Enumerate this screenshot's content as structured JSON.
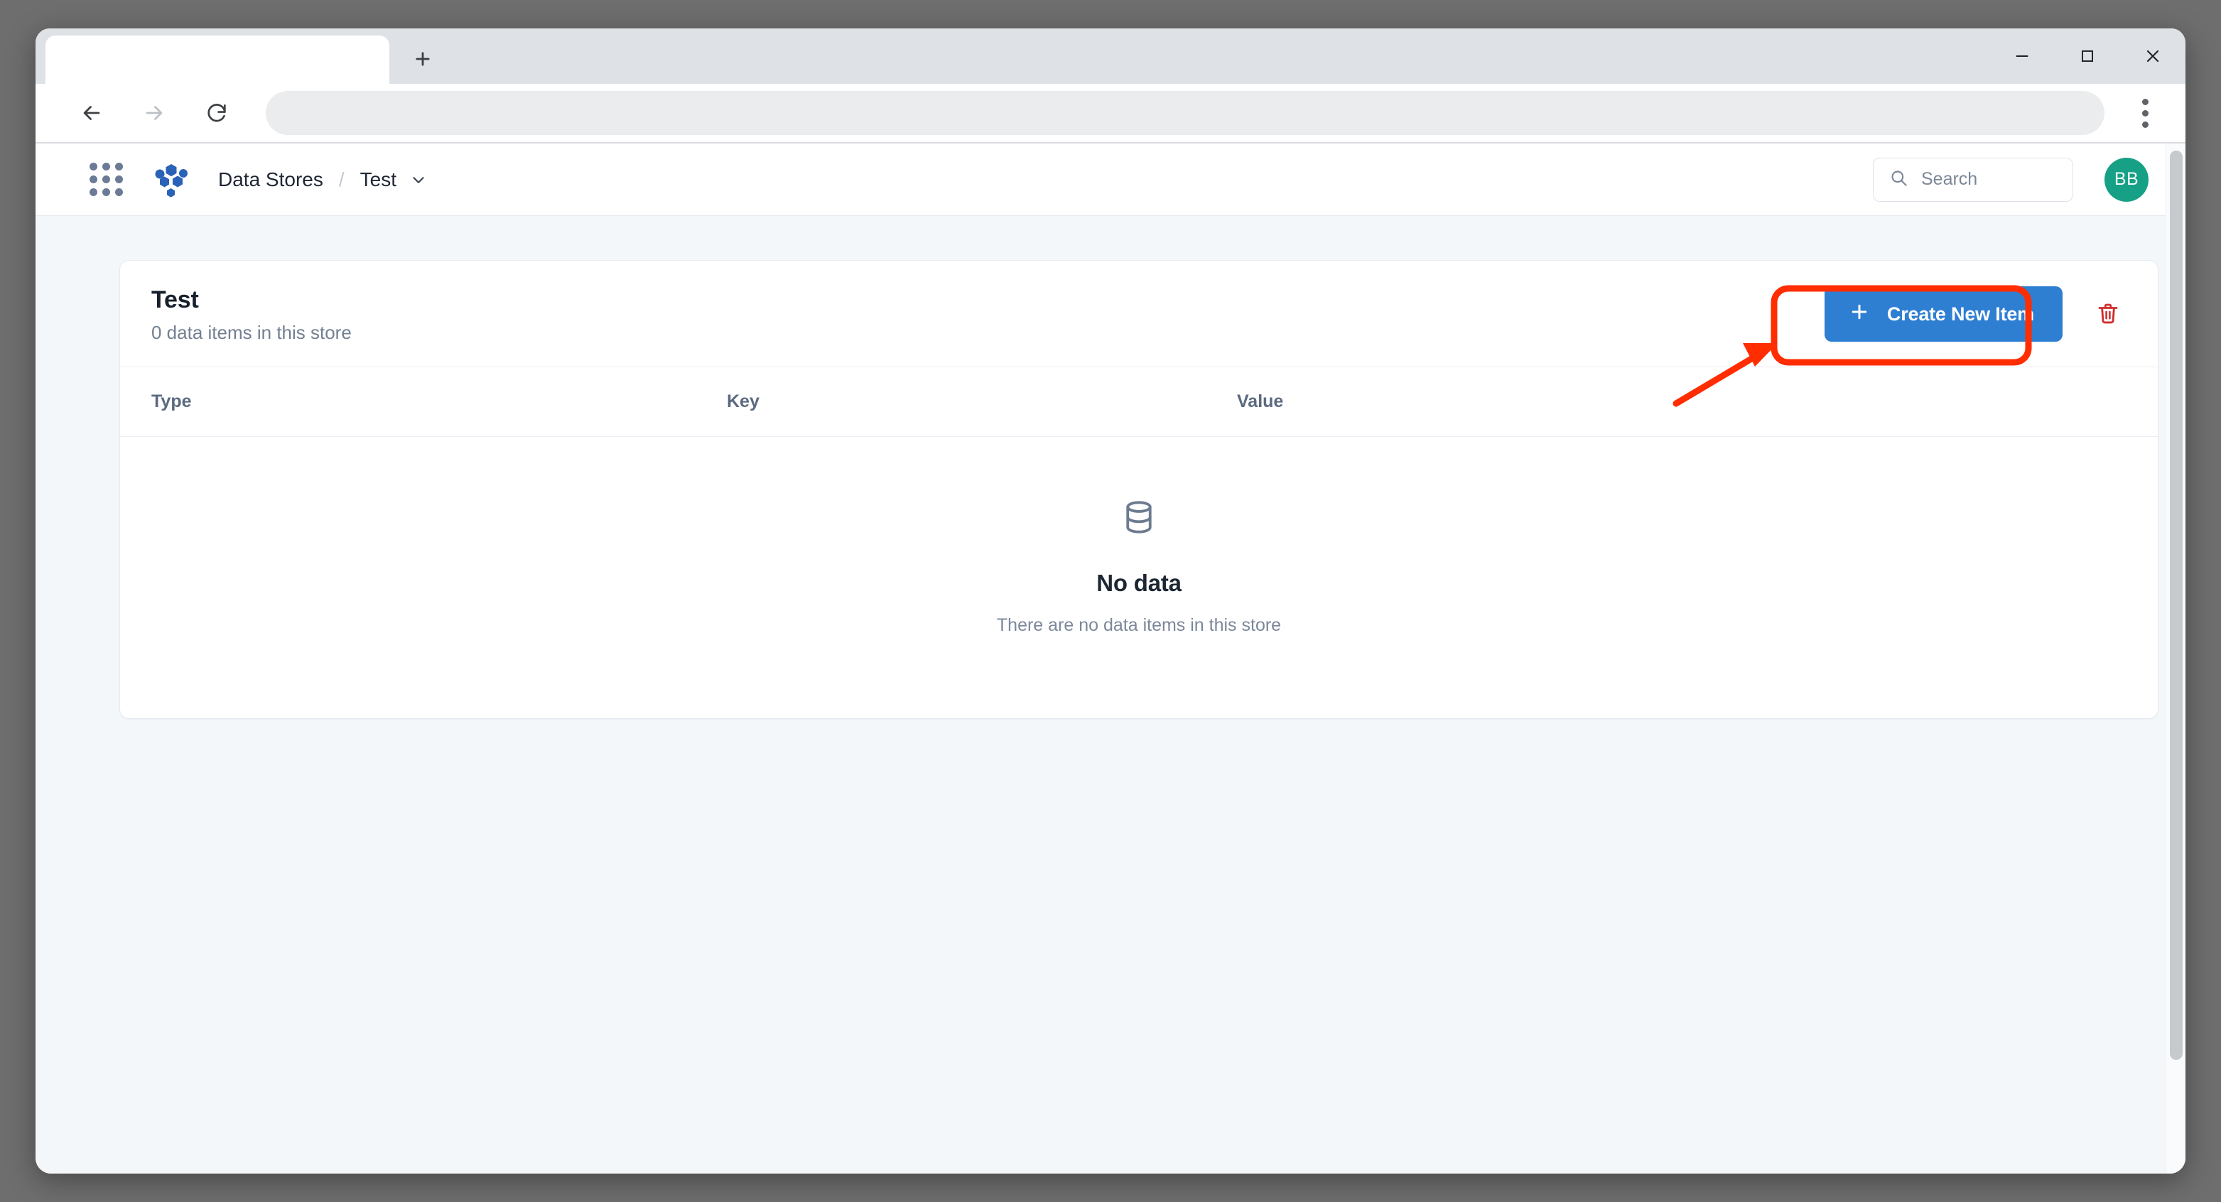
{
  "browser": {
    "tab": {
      "title": "",
      "name": "browser-tab"
    },
    "new_tab_label": "+",
    "window_controls": {
      "minimize": "—",
      "maximize": "□",
      "close": "✕"
    },
    "toolbar": {
      "back_icon": "arrow-left-icon",
      "forward_icon": "arrow-right-icon",
      "reload_icon": "reload-icon",
      "address_value": "",
      "menu_icon": "kebab-menu-icon"
    }
  },
  "app_header": {
    "apps_grid_icon": "apps-grid-icon",
    "logo_icon": "hexagon-cluster-logo",
    "breadcrumb": {
      "root": "Data Stores",
      "separator": "/",
      "current": "Test",
      "caret_icon": "chevron-down-icon"
    },
    "search": {
      "placeholder": "Search",
      "value": "",
      "icon": "search-icon"
    },
    "avatar": {
      "initials": "BB",
      "color": "#16a085"
    }
  },
  "card": {
    "title": "Test",
    "subtitle": "0 data items in this store",
    "create_button": {
      "label": "Create New Item",
      "icon": "plus-icon",
      "color": "#2e7fd1"
    },
    "delete_button": {
      "icon": "trash-icon",
      "color": "#cf2e2e"
    },
    "table": {
      "columns": [
        "Type",
        "Key",
        "Value"
      ],
      "rows": []
    },
    "empty_state": {
      "icon": "database-icon",
      "title": "No data",
      "subtitle": "There are no data items in this store"
    }
  },
  "annotation": {
    "highlight_color": "#ff2d00",
    "highlight_target": "create-new-item-button",
    "arrow": "red-arrow-pointing-to-create-new-item-button"
  },
  "colors": {
    "page_background": "#f4f7fa",
    "card_background": "#ffffff",
    "primary": "#2e7fd1",
    "danger": "#cf2e2e",
    "avatar": "#16a085",
    "desktop": "#6e6e6e",
    "chrome": "#dee1e6"
  }
}
